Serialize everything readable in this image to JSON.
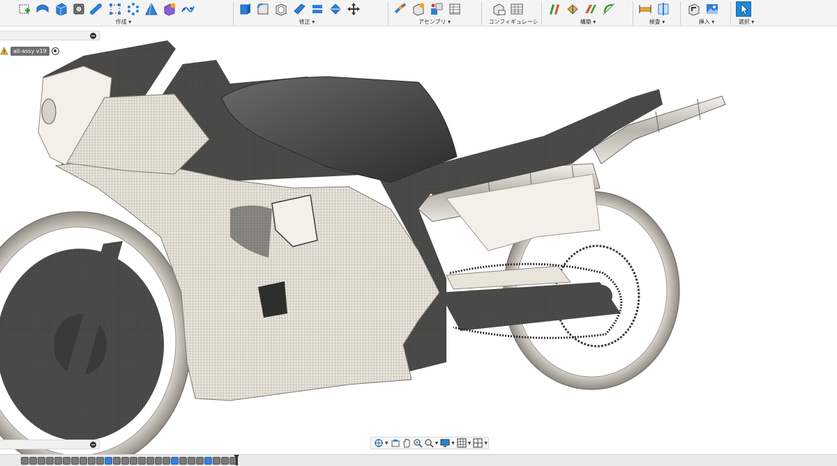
{
  "toolbar": {
    "groups": [
      {
        "label": "作成 ▾",
        "icons": [
          "sketch-icon",
          "extrude-icon",
          "box-icon",
          "cylinder-icon",
          "pipe-icon",
          "form-icon",
          "pattern-icon",
          "cone-icon",
          "insert-derive-icon",
          "freeform-icon"
        ]
      },
      {
        "label": "修正 ▾",
        "icons": [
          "press-pull-icon",
          "fillet-icon",
          "shell-icon",
          "face-icon",
          "split-icon",
          "scale-icon",
          "move-icon"
        ]
      },
      {
        "label": "アセンブリ ▾",
        "icons": [
          "joint-icon",
          "component-icon",
          "rigid-group-icon",
          "as-built-icon"
        ]
      },
      {
        "label": "コンフィギュレーション ▾",
        "icons": [
          "configure-icon",
          "table-icon"
        ]
      },
      {
        "label": "構築 ▾",
        "icons": [
          "offset-plane-icon",
          "plane-angle-icon",
          "midplane-icon",
          "axis-icon"
        ]
      },
      {
        "label": "検査 ▾",
        "icons": [
          "measure-icon",
          "section-analysis-icon"
        ]
      },
      {
        "label": "挿入 ▾",
        "icons": [
          "insert-mesh-icon",
          "canvas-icon"
        ]
      },
      {
        "label": "選択 ▾",
        "icons": [
          "select-arrow-icon"
        ]
      }
    ]
  },
  "browser": {
    "document_name": "all-assy v19"
  },
  "colors": {
    "toolbar_bg": "#f4f4f4",
    "accent_blue": "#1f8ad6",
    "mesh_dark": "#4a4a48",
    "fairing_light": "#e6e2d8"
  },
  "navbar": {
    "icons": [
      "orbit-icon",
      "look-at-icon",
      "pan-icon",
      "zoom-window-icon",
      "zoom-icon",
      "display-settings-icon",
      "grid-icon",
      "viewports-icon"
    ]
  },
  "timeline": {
    "feature_count": 26
  }
}
